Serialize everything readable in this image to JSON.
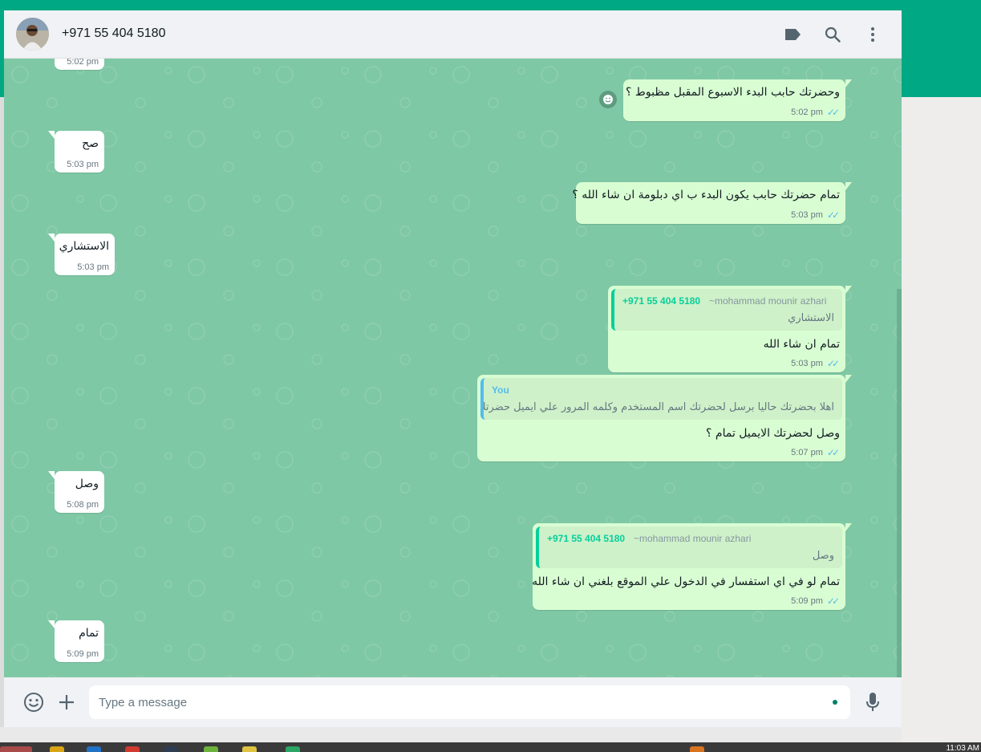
{
  "header": {
    "contact_name": "+971 55 404 5180",
    "icons": [
      "label-icon",
      "search-icon",
      "menu-icon"
    ]
  },
  "messages": [
    {
      "dir": "in",
      "text": "",
      "time": "5:02 pm"
    },
    {
      "dir": "out",
      "text": "وحضرتك حابب البدء الاسبوع المقبل مظبوط ؟",
      "time": "5:02 pm",
      "read": true
    },
    {
      "dir": "in",
      "text": "صح",
      "time": "5:03 pm"
    },
    {
      "dir": "out",
      "text": "تمام حضرتك حابب يكون البدء ب اي دبلومة ان شاء الله ؟",
      "time": "5:03 pm",
      "read": true
    },
    {
      "dir": "in",
      "text": "الاستشاري",
      "time": "5:03 pm"
    },
    {
      "dir": "out",
      "quote": {
        "author_number": "+971 55 404 5180",
        "author_name": "~mohammad mounir azhari",
        "text": "الاستشاري"
      },
      "text": "تمام ان شاء الله",
      "time": "5:03 pm",
      "read": true
    },
    {
      "dir": "out",
      "quote": {
        "author": "You",
        "text": "اهلا بحضرتك حاليا برسل لحضرتك اسم المستخدم وكلمه المرور علي ايميل حضرتك"
      },
      "text": "وصل لحضرتك الايميل تمام ؟",
      "time": "5:07 pm",
      "read": true
    },
    {
      "dir": "in",
      "text": "وصل",
      "time": "5:08 pm"
    },
    {
      "dir": "out",
      "quote": {
        "author_number": "+971 55 404 5180",
        "author_name": "~mohammad mounir azhari",
        "text": "وصل"
      },
      "text": "تمام لو في اي استفسار في الدخول علي الموقع بلغني ان شاء الله",
      "time": "5:09 pm",
      "read": true
    },
    {
      "dir": "in",
      "text": "تمام",
      "time": "5:09 pm"
    }
  ],
  "composer": {
    "placeholder": "Type a message",
    "value": ""
  },
  "taskbar": {
    "time": "11:03 AM"
  },
  "colors": {
    "brand": "#00a884",
    "chat_bg": "#7fc8a5",
    "outgoing_bubble": "#d9fdd3",
    "incoming_bubble": "#ffffff",
    "read_ticks": "#53bdeb"
  }
}
